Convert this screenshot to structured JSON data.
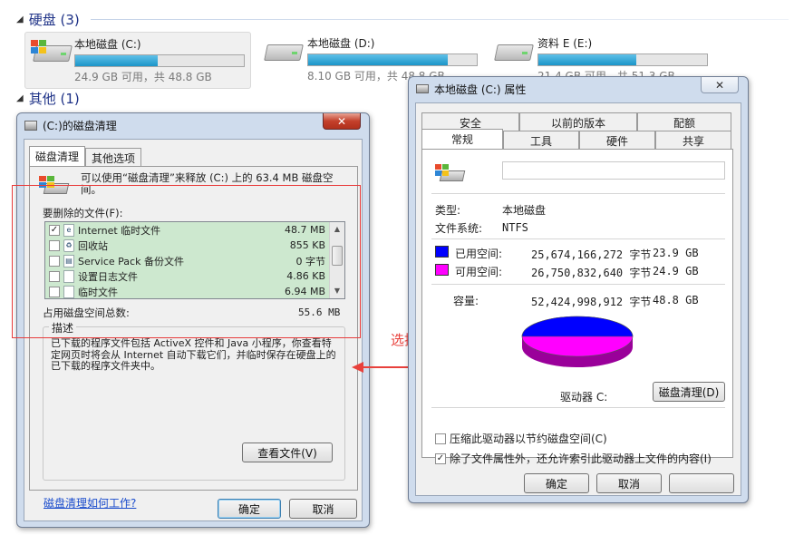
{
  "explorer": {
    "hard_disks_title": "硬盘 (3)",
    "other_title": "其他 (1)",
    "drives": [
      {
        "name": "本地磁盘 (C:)",
        "free_text": "24.9 GB 可用，共 48.8 GB",
        "used_fraction": 0.49
      },
      {
        "name": "本地磁盘 (D:)",
        "free_text": "8.10 GB 可用，共 48.8 GB",
        "used_fraction": 0.83
      },
      {
        "name": "资料 E (E:)",
        "free_text": "21.4 GB 可用，共 51.3 GB",
        "used_fraction": 0.58
      }
    ]
  },
  "cleanup": {
    "title": "(C:)的磁盘清理",
    "close": "✕",
    "tabs": [
      "磁盘清理",
      "其他选项"
    ],
    "intro": "可以使用“磁盘清理”来释放 (C:) 上的 63.4 MB 磁盘空间。",
    "files_label": "要删除的文件(F):",
    "files": [
      {
        "name": "Internet 临时文件",
        "size": "48.7 MB",
        "checked": "✓"
      },
      {
        "name": "回收站",
        "size": "855 KB",
        "checked": ""
      },
      {
        "name": "Service Pack 备份文件",
        "size": "0 字节",
        "checked": ""
      },
      {
        "name": "设置日志文件",
        "size": "4.86 KB",
        "checked": ""
      },
      {
        "name": "临时文件",
        "size": "6.94 MB",
        "checked": ""
      }
    ],
    "total_label": "占用磁盘空间总数:",
    "total_value": "55.6 MB",
    "desc_label": "描述",
    "desc_text": "已下载的程序文件包括 ActiveX 控件和 Java 小程序，你查看特定网页时将会从 Internet 自动下载它们，并临时保存在硬盘上的已下载的程序文件夹中。",
    "view_files": "查看文件(V)",
    "how_link": "磁盘清理如何工作?",
    "ok": "确定",
    "cancel": "取消"
  },
  "annotation": "选择要删除的文件",
  "props": {
    "title": "本地磁盘 (C:) 属性",
    "close": "✕",
    "tabs_top": [
      "安全",
      "以前的版本",
      "配额"
    ],
    "tabs_bottom": [
      "常规",
      "工具",
      "硬件",
      "共享"
    ],
    "type_label": "类型:",
    "type_value": "本地磁盘",
    "fs_label": "文件系统:",
    "fs_value": "NTFS",
    "used_label": "已用空间:",
    "used_bytes": "25,674,166,272 字节",
    "used_gb": "23.9 GB",
    "free_label": "可用空间:",
    "free_bytes": "26,750,832,640 字节",
    "free_gb": "24.9 GB",
    "cap_label": "容量:",
    "cap_bytes": "52,424,998,912 字节",
    "cap_gb": "48.8 GB",
    "drive_label": "驱动器 C:",
    "cleanup_btn": "磁盘清理(D)",
    "compress": "压缩此驱动器以节约磁盘空间(C)",
    "index": "除了文件属性外，还允许索引此驱动器上文件的内容(I)",
    "index_checked": "✓",
    "ok": "确定",
    "cancel": "取消",
    "used_color": "#0000ff",
    "free_color": "#ff00ff"
  }
}
